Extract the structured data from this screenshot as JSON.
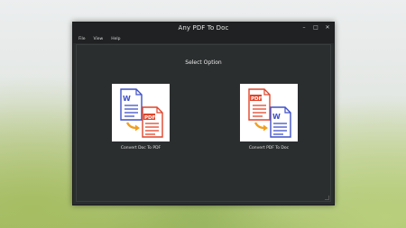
{
  "window": {
    "title": "Any PDF To Doc",
    "controls": {
      "minimize": "–",
      "maximize": "□",
      "close": "✕"
    }
  },
  "menu": {
    "items": [
      {
        "label": "File"
      },
      {
        "label": "View"
      },
      {
        "label": "Help"
      }
    ]
  },
  "main": {
    "heading": "Select Option",
    "options": [
      {
        "label": "Convert Doc To PDF",
        "icons": [
          "word-doc-icon",
          "arrow-icon",
          "pdf-doc-icon"
        ]
      },
      {
        "label": "Convert PDF To Doc",
        "icons": [
          "pdf-doc-icon",
          "arrow-icon",
          "word-doc-icon"
        ]
      }
    ]
  },
  "icon_text": {
    "word": "W",
    "pdf": "PDF"
  },
  "colors": {
    "word_blue": "#3f51c6",
    "pdf_red": "#e0452b",
    "arrow_orange": "#f0a020",
    "window_bg": "#2a2d2e",
    "titlebar_bg": "#1f2122"
  }
}
